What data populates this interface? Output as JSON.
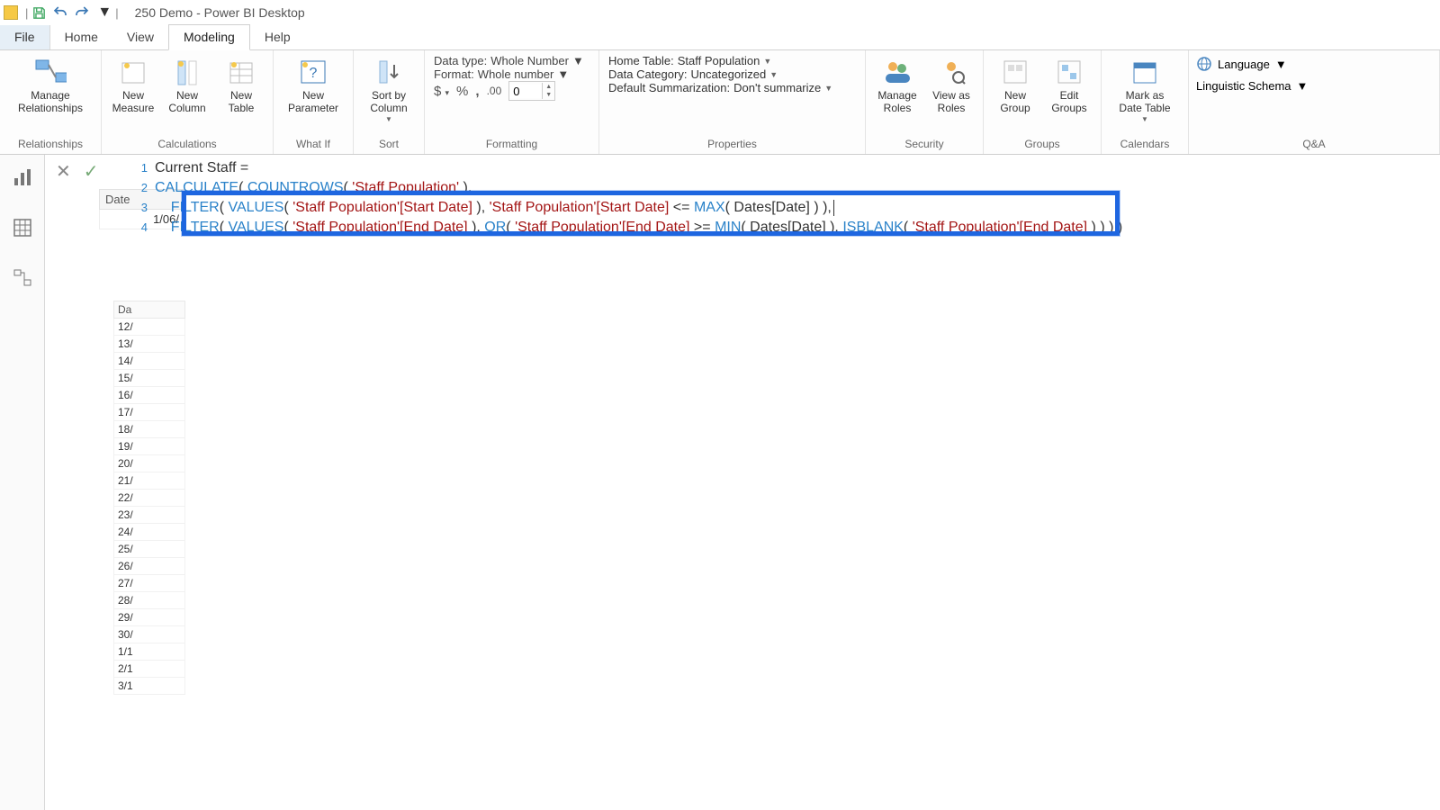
{
  "title": "250 Demo - Power BI Desktop",
  "menu": {
    "file": "File",
    "home": "Home",
    "view": "View",
    "modeling": "Modeling",
    "help": "Help"
  },
  "ribbon": {
    "relationships": {
      "manage": "Manage\nRelationships",
      "group": "Relationships"
    },
    "calculations": {
      "newMeasure": "New\nMeasure",
      "newColumn": "New\nColumn",
      "newTable": "New\nTable",
      "group": "Calculations"
    },
    "whatif": {
      "newParameter": "New\nParameter",
      "group": "What If"
    },
    "sort": {
      "sortBy": "Sort by\nColumn",
      "group": "Sort"
    },
    "formatting": {
      "dataTypeLabel": "Data type:",
      "dataTypeValue": "Whole Number",
      "formatLabel": "Format:",
      "formatValue": "Whole number",
      "decimals": "0",
      "group": "Formatting"
    },
    "properties": {
      "homeTableLabel": "Home Table:",
      "homeTableValue": "Staff Population",
      "dataCategoryLabel": "Data Category:",
      "dataCategoryValue": "Uncategorized",
      "defaultSumLabel": "Default Summarization:",
      "defaultSumValue": "Don't summarize",
      "group": "Properties"
    },
    "security": {
      "manageRoles": "Manage\nRoles",
      "viewAs": "View as\nRoles",
      "group": "Security"
    },
    "groups": {
      "newGroup": "New\nGroup",
      "editGroups": "Edit\nGroups",
      "group": "Groups"
    },
    "calendars": {
      "markAs": "Mark as\nDate Table",
      "group": "Calendars"
    },
    "qa": {
      "language": "Language",
      "schema": "Linguistic Schema",
      "group": "Q&A"
    }
  },
  "formula": {
    "line1_a": "Current Staff =",
    "line2_calc": "CALCULATE",
    "line2_count": "COUNTROWS",
    "line2_arg": "'Staff Population'",
    "line3_filter": "FILTER",
    "line3_values": "VALUES",
    "line3_col": "'Staff Population'[Start Date]",
    "line3_col2": "'Staff Population'[Start Date]",
    "line3_op": "<=",
    "line3_max": "MAX",
    "line3_dates": "Dates[Date]",
    "line4_filter": "FILTER",
    "line4_values": "VALUES",
    "line4_col": "'Staff Population'[End Date]",
    "line4_or": "OR",
    "line4_col2": "'Staff Population'[End Date]",
    "line4_op": ">=",
    "line4_min": "MIN",
    "line4_dates": "Dates[Date]",
    "line4_isblank": "ISBLANK",
    "line4_col3": "'Staff Population'[End Date]"
  },
  "gridDateHdr": "Date",
  "gridDateVal": "1/06/",
  "grid2Hdr": "Da",
  "grid2Rows": [
    "12/",
    "13/",
    "14/",
    "15/",
    "16/",
    "17/",
    "18/",
    "19/",
    "20/",
    "21/",
    "22/",
    "23/",
    "24/",
    "25/",
    "26/",
    "27/",
    "28/",
    "29/",
    "30/",
    "1/1",
    "2/1",
    "3/1"
  ]
}
